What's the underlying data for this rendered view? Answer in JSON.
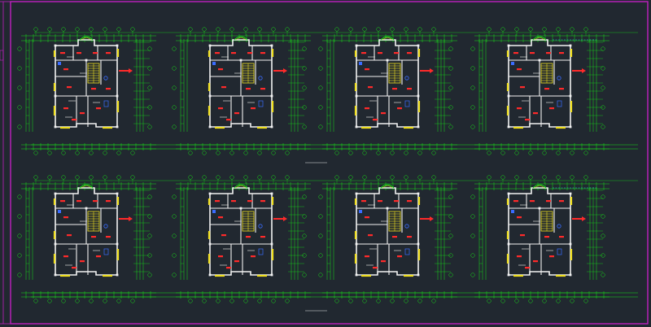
{
  "drawing": {
    "rows": [
      {
        "plan_count": 4,
        "caption": ""
      },
      {
        "plan_count": 4,
        "caption": ""
      }
    ]
  },
  "colors": {
    "background": "#212830",
    "frame": "#c020c0",
    "dimension": "#18e018",
    "wall": "#f2f2f2",
    "window": "#f0e020",
    "room_label": "#ff2a2a",
    "fixture": "#3a6cff",
    "leader": "#29c6d8"
  },
  "icons": {
    "entrance_arrow": "red-arrow-icon",
    "stair": "stair-icon",
    "axis_bubble": "axis-bubble-icon"
  }
}
